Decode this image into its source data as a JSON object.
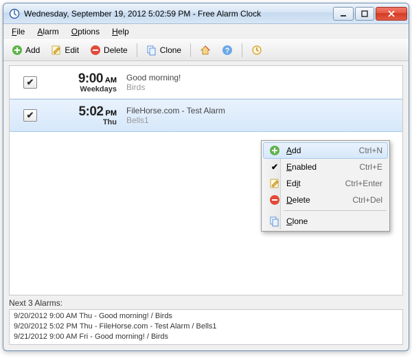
{
  "title": "Wednesday, September 19, 2012 5:02:59 PM - Free Alarm Clock",
  "menu": {
    "file": "File",
    "alarm": "Alarm",
    "options": "Options",
    "help": "Help"
  },
  "toolbar": {
    "add": "Add",
    "edit": "Edit",
    "delete": "Delete",
    "clone": "Clone"
  },
  "alarms": [
    {
      "enabled_check": "✔",
      "time": "9:00",
      "ampm": "AM",
      "days": "Weekdays",
      "title": "Good morning!",
      "sound": "Birds"
    },
    {
      "enabled_check": "✔",
      "time": "5:02",
      "ampm": "PM",
      "days": "Thu",
      "title": "FileHorse.com - Test Alarm",
      "sound": "Bells1"
    }
  ],
  "context": {
    "add": "Add",
    "add_accel": "Ctrl+N",
    "enabled": "Enabled",
    "enabled_accel": "Ctrl+E",
    "edit": "Edit",
    "edit_accel": "Ctrl+Enter",
    "delete": "Delete",
    "delete_accel": "Ctrl+Del",
    "clone": "Clone",
    "enabled_check": "✔"
  },
  "status": {
    "label": "Next 3 Alarms:",
    "lines": [
      "9/20/2012 9:00 AM Thu - Good morning! / Birds",
      "9/20/2012 5:02 PM Thu - FileHorse.com - Test Alarm / Bells1",
      "9/21/2012 9:00 AM Fri - Good morning! / Birds"
    ]
  }
}
